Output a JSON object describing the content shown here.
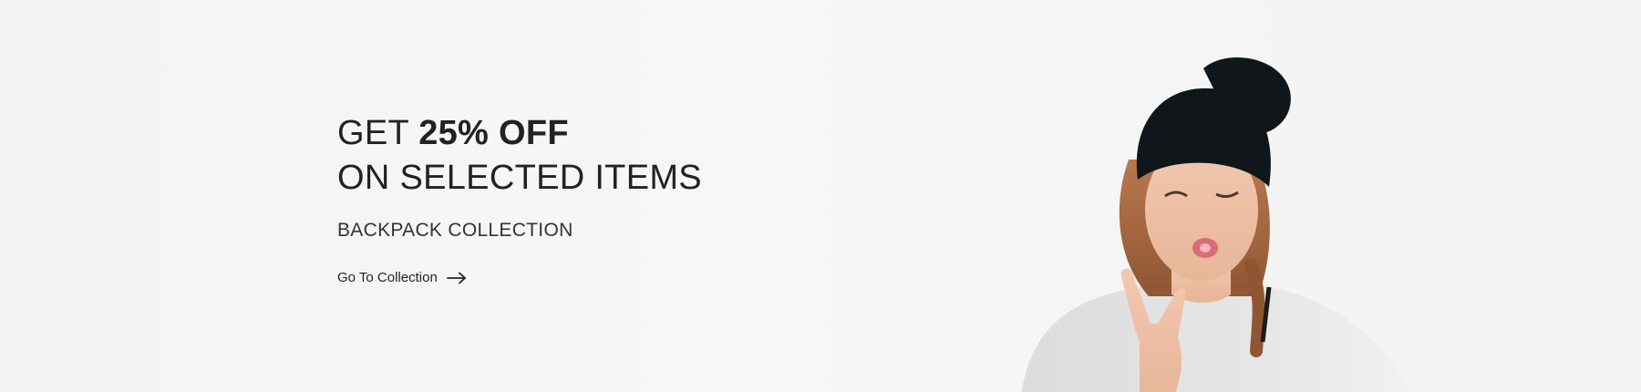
{
  "promo": {
    "headline_prefix": "GET ",
    "headline_highlight": "25% OFF",
    "headline_line2": "ON SELECTED ITEMS",
    "subheading": "BACKPACK COLLECTION",
    "cta_label": "Go To Collection",
    "cta_icon": "arrow-right-icon"
  },
  "colors": {
    "background": "#f4f5f4",
    "text": "#222222",
    "hat": "#10161a"
  }
}
